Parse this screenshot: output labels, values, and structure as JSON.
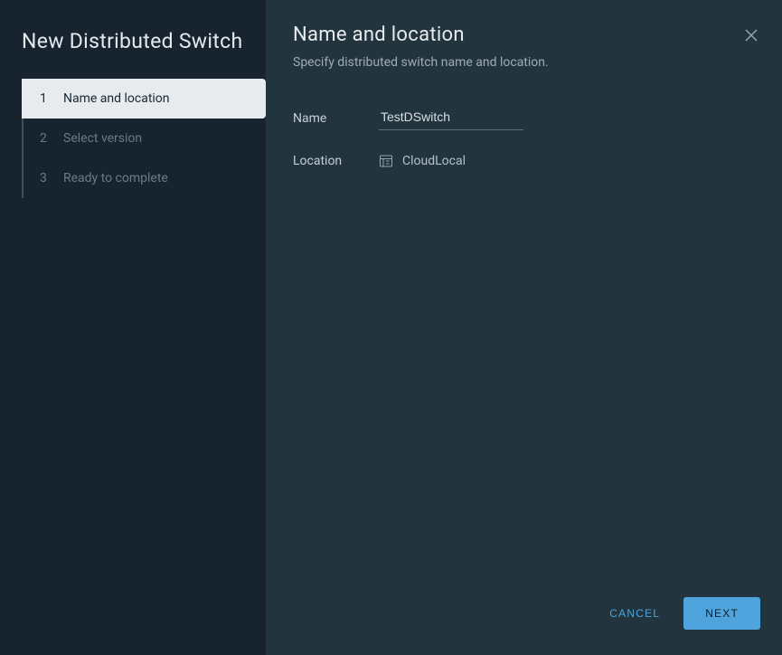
{
  "wizard": {
    "title": "New Distributed Switch"
  },
  "steps": [
    {
      "number": "1",
      "label": "Name and location",
      "active": true
    },
    {
      "number": "2",
      "label": "Select version",
      "active": false
    },
    {
      "number": "3",
      "label": "Ready to complete",
      "active": false
    }
  ],
  "content": {
    "title": "Name and location",
    "subtitle": "Specify distributed switch name and location."
  },
  "form": {
    "name_label": "Name",
    "name_value": "TestDSwitch",
    "location_label": "Location",
    "location_value": "CloudLocal"
  },
  "footer": {
    "cancel_label": "CANCEL",
    "next_label": "NEXT"
  }
}
